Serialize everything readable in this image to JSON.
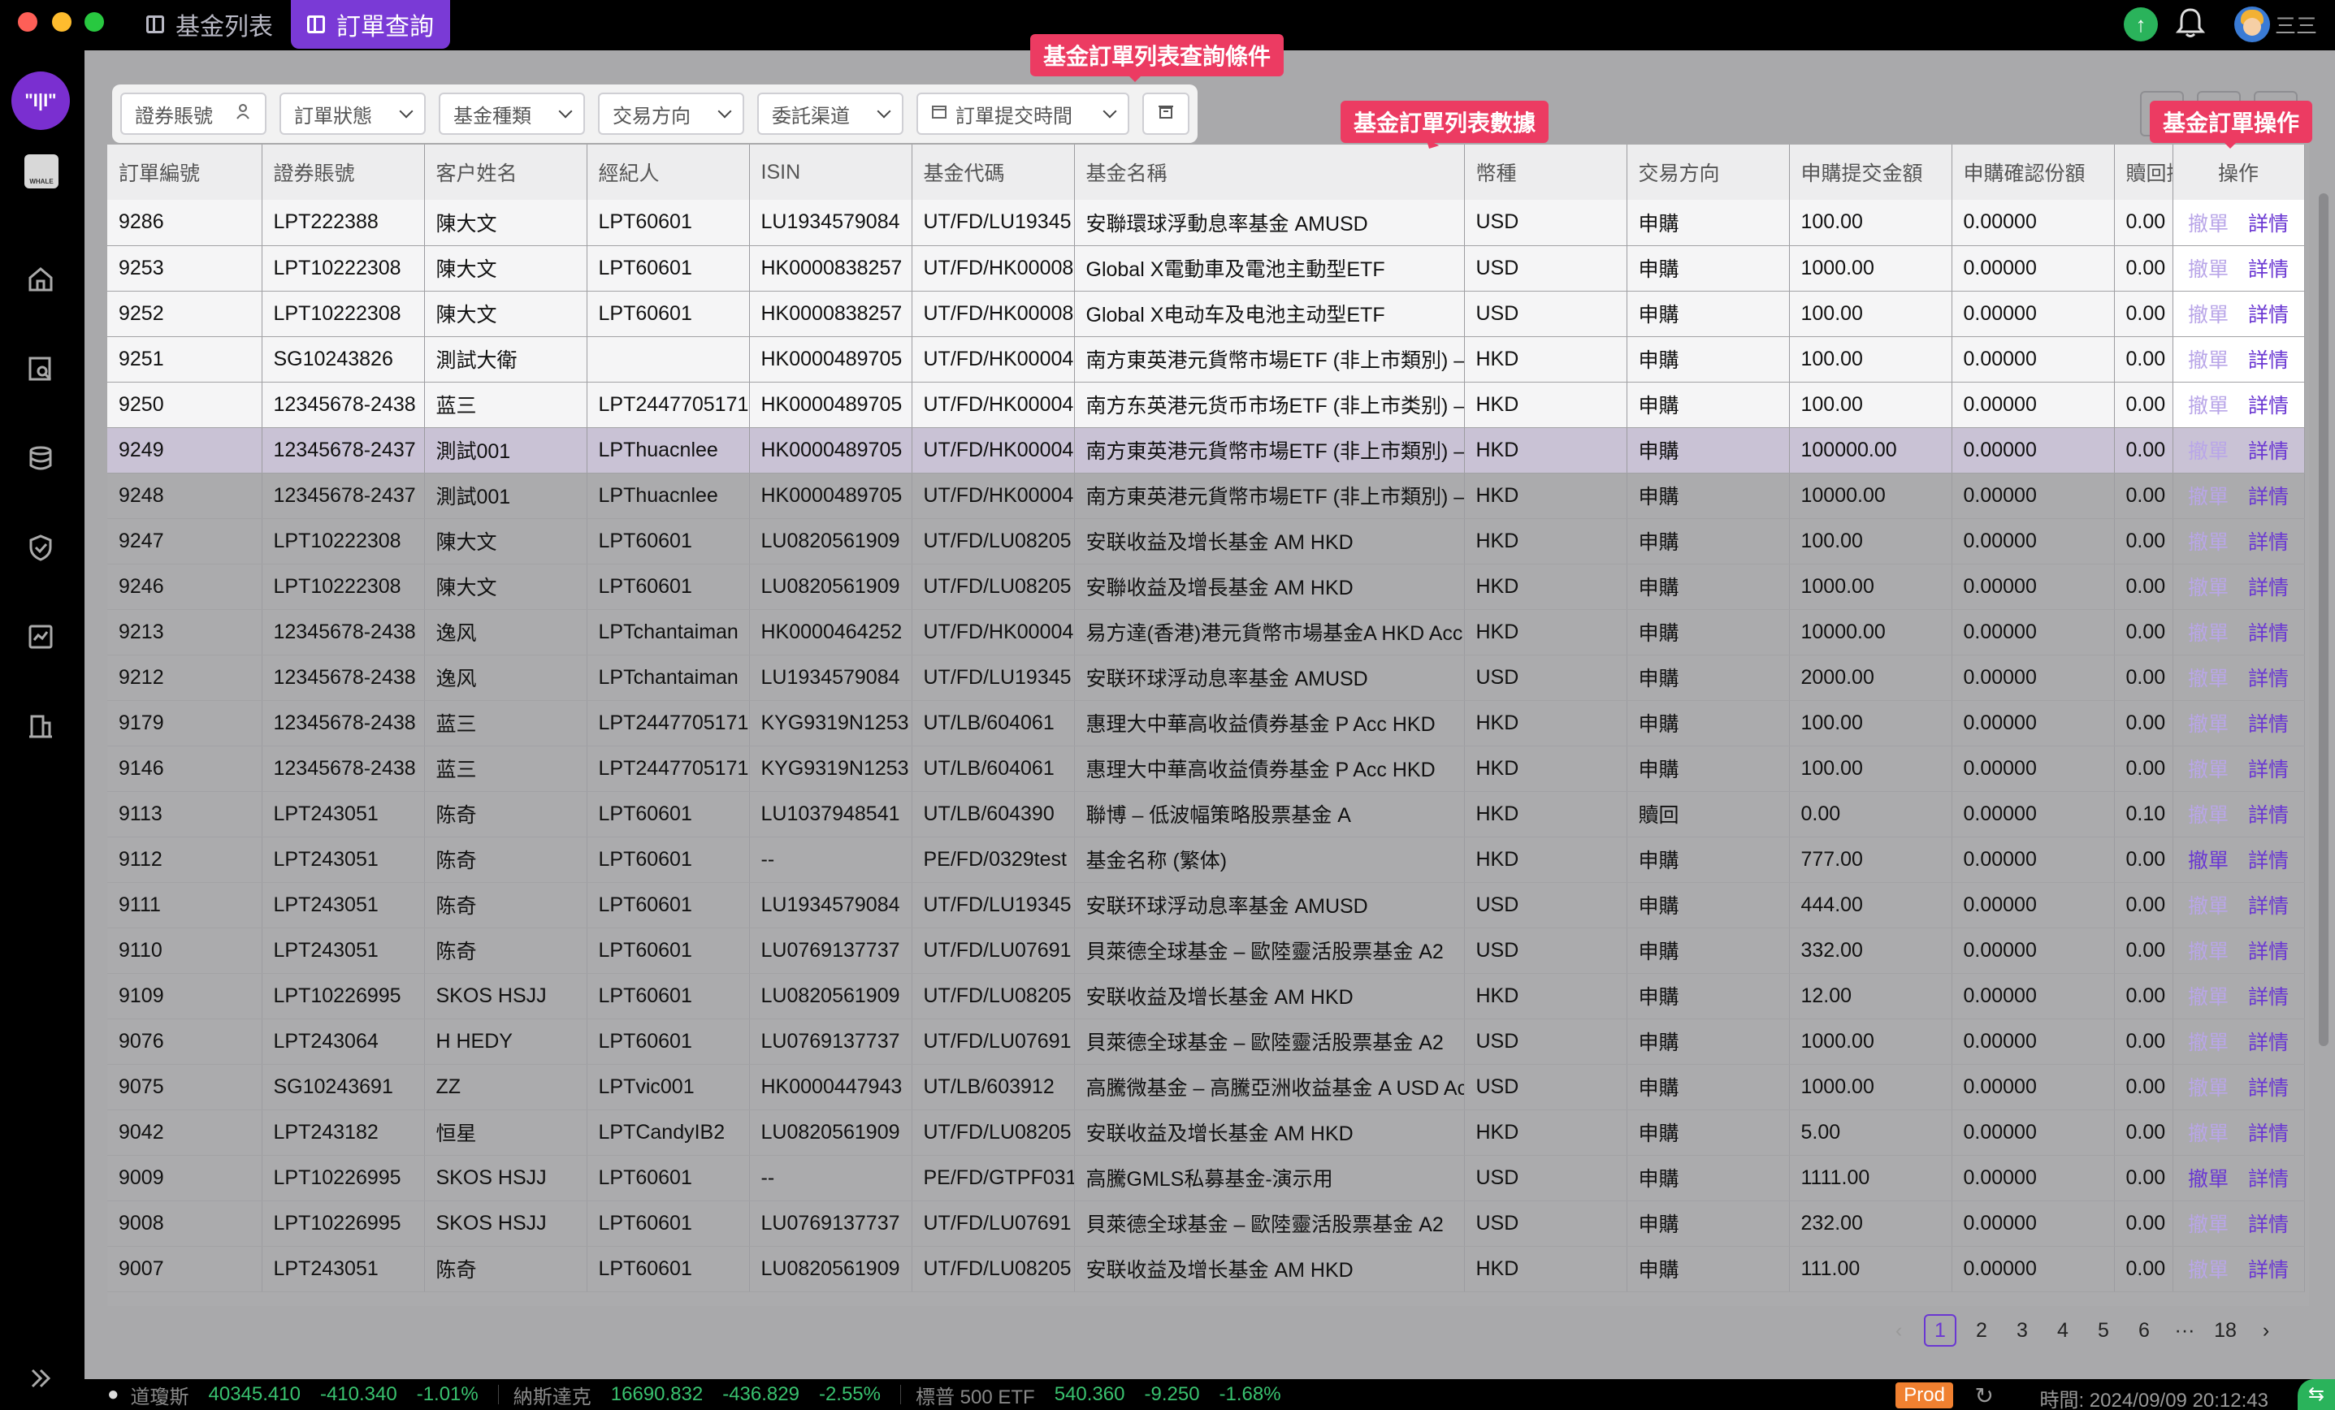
{
  "titlebar": {
    "tabs": [
      {
        "label": "基金列表",
        "active": false
      },
      {
        "label": "訂單查詢",
        "active": true
      }
    ],
    "user_menu": "三三"
  },
  "sidebar": {
    "logo_text": "\"I|I\"",
    "whale_text": "WHALE",
    "items": [
      "home-icon",
      "search-doc-icon",
      "database-icon",
      "shield-icon",
      "report-icon",
      "building-icon"
    ],
    "expand_icon": "double-chevron-right-icon"
  },
  "filters": {
    "account": "證券賬號",
    "status": "訂單狀態",
    "fund_type": "基金種類",
    "direction": "交易方向",
    "channel": "委託渠道",
    "submit_time": "訂單提交時間"
  },
  "annotations": {
    "filters": "基金訂單列表查詢條件",
    "table": "基金訂單列表數據",
    "ops": "基金訂單操作"
  },
  "table": {
    "headers": [
      "訂單編號",
      "證券賬號",
      "客户姓名",
      "經紀人",
      "ISIN",
      "基金代碼",
      "基金名稱",
      "幣種",
      "交易方向",
      "申購提交金額",
      "申購確認份額",
      "贖回提"
    ],
    "ops_header": "操作",
    "cancel_label": "撤單",
    "detail_label": "詳情",
    "rows": [
      {
        "c": [
          "9286",
          "LPT222388",
          "陳大文",
          "LPT60601",
          "LU1934579084",
          "UT/FD/LU19345",
          "安聯環球浮動息率基金 AMUSD",
          "USD",
          "申購",
          "100.00",
          "0.00000",
          "0.00"
        ],
        "style": "hl",
        "cancel": false
      },
      {
        "c": [
          "9253",
          "LPT10222308",
          "陳大文",
          "LPT60601",
          "HK0000838257",
          "UT/FD/HK00008",
          "Global X電動車及電池主動型ETF",
          "USD",
          "申購",
          "1000.00",
          "0.00000",
          "0.00"
        ],
        "style": "hl",
        "cancel": false
      },
      {
        "c": [
          "9252",
          "LPT10222308",
          "陳大文",
          "LPT60601",
          "HK0000838257",
          "UT/FD/HK00008",
          "Global X电动车及电池主动型ETF",
          "USD",
          "申購",
          "100.00",
          "0.00000",
          "0.00"
        ],
        "style": "hl",
        "cancel": false
      },
      {
        "c": [
          "9251",
          "SG10243826",
          "測試大衛",
          "",
          "HK0000489705",
          "UT/FD/HK00004",
          "南方東英港元貨幣市場ETF (非上市類別) – A",
          "HKD",
          "申購",
          "100.00",
          "0.00000",
          "0.00"
        ],
        "style": "hl",
        "cancel": false
      },
      {
        "c": [
          "9250",
          "12345678-2438",
          "蓝三",
          "LPT2447705171",
          "HK0000489705",
          "UT/FD/HK00004",
          "南方东英港元货币市场ETF (非上市类别) – A",
          "HKD",
          "申購",
          "100.00",
          "0.00000",
          "0.00"
        ],
        "style": "hl",
        "cancel": false
      },
      {
        "c": [
          "9249",
          "12345678-2437",
          "測試001",
          "LPThuacnlee",
          "HK0000489705",
          "UT/FD/HK00004",
          "南方東英港元貨幣市場ETF (非上市類別) – A",
          "HKD",
          "申購",
          "100000.00",
          "0.00000",
          "0.00"
        ],
        "style": "sel",
        "cancel": false
      },
      {
        "c": [
          "9248",
          "12345678-2437",
          "測試001",
          "LPThuacnlee",
          "HK0000489705",
          "UT/FD/HK00004",
          "南方東英港元貨幣市場ETF (非上市類別) – A",
          "HKD",
          "申購",
          "10000.00",
          "0.00000",
          "0.00"
        ],
        "style": "",
        "cancel": false
      },
      {
        "c": [
          "9247",
          "LPT10222308",
          "陳大文",
          "LPT60601",
          "LU0820561909",
          "UT/FD/LU08205",
          "安联收益及增长基金 AM HKD",
          "HKD",
          "申購",
          "100.00",
          "0.00000",
          "0.00"
        ],
        "style": "",
        "cancel": false
      },
      {
        "c": [
          "9246",
          "LPT10222308",
          "陳大文",
          "LPT60601",
          "LU0820561909",
          "UT/FD/LU08205",
          "安聯收益及增長基金 AM HKD",
          "HKD",
          "申購",
          "1000.00",
          "0.00000",
          "0.00"
        ],
        "style": "",
        "cancel": false
      },
      {
        "c": [
          "9213",
          "12345678-2438",
          "逸风",
          "LPTchantaiman",
          "HK0000464252",
          "UT/FD/HK00004",
          "易方達(香港)港元貨幣市場基金A HKD Acc",
          "HKD",
          "申購",
          "10000.00",
          "0.00000",
          "0.00"
        ],
        "style": "",
        "cancel": false
      },
      {
        "c": [
          "9212",
          "12345678-2438",
          "逸风",
          "LPTchantaiman",
          "LU1934579084",
          "UT/FD/LU19345",
          "安联环球浮动息率基金 AMUSD",
          "USD",
          "申購",
          "2000.00",
          "0.00000",
          "0.00"
        ],
        "style": "",
        "cancel": false
      },
      {
        "c": [
          "9179",
          "12345678-2438",
          "蓝三",
          "LPT2447705171",
          "KYG9319N1253",
          "UT/LB/604061",
          "惠理大中華高收益債券基金 P Acc HKD",
          "HKD",
          "申購",
          "100.00",
          "0.00000",
          "0.00"
        ],
        "style": "",
        "cancel": false
      },
      {
        "c": [
          "9146",
          "12345678-2438",
          "蓝三",
          "LPT2447705171",
          "KYG9319N1253",
          "UT/LB/604061",
          "惠理大中華高收益債券基金 P Acc HKD",
          "HKD",
          "申購",
          "100.00",
          "0.00000",
          "0.00"
        ],
        "style": "",
        "cancel": false
      },
      {
        "c": [
          "9113",
          "LPT243051",
          "陈奇",
          "LPT60601",
          "LU1037948541",
          "UT/LB/604390",
          "聯博 – 低波幅策略股票基金 A",
          "HKD",
          "贖回",
          "0.00",
          "0.00000",
          "0.10"
        ],
        "style": "",
        "cancel": false
      },
      {
        "c": [
          "9112",
          "LPT243051",
          "陈奇",
          "LPT60601",
          "--",
          "PE/FD/0329test",
          "基金名称 (繁体)",
          "HKD",
          "申購",
          "777.00",
          "0.00000",
          "0.00"
        ],
        "style": "",
        "cancel": true
      },
      {
        "c": [
          "9111",
          "LPT243051",
          "陈奇",
          "LPT60601",
          "LU1934579084",
          "UT/FD/LU19345",
          "安联环球浮动息率基金 AMUSD",
          "USD",
          "申購",
          "444.00",
          "0.00000",
          "0.00"
        ],
        "style": "",
        "cancel": false
      },
      {
        "c": [
          "9110",
          "LPT243051",
          "陈奇",
          "LPT60601",
          "LU0769137737",
          "UT/FD/LU07691",
          "貝萊德全球基金 – 歐陸靈活股票基金 A2",
          "USD",
          "申購",
          "332.00",
          "0.00000",
          "0.00"
        ],
        "style": "",
        "cancel": false
      },
      {
        "c": [
          "9109",
          "LPT10226995",
          "SKOS HSJJ",
          "LPT60601",
          "LU0820561909",
          "UT/FD/LU08205",
          "安联收益及增长基金 AM HKD",
          "HKD",
          "申購",
          "12.00",
          "0.00000",
          "0.00"
        ],
        "style": "",
        "cancel": false
      },
      {
        "c": [
          "9076",
          "LPT243064",
          "H HEDY",
          "LPT60601",
          "LU0769137737",
          "UT/FD/LU07691",
          "貝萊德全球基金 – 歐陸靈活股票基金 A2",
          "USD",
          "申購",
          "1000.00",
          "0.00000",
          "0.00"
        ],
        "style": "",
        "cancel": false
      },
      {
        "c": [
          "9075",
          "SG10243691",
          "ZZ",
          "LPTvic001",
          "HK0000447943",
          "UT/LB/603912",
          "高騰微基金 – 高騰亞洲收益基金 A USD Acc",
          "USD",
          "申購",
          "1000.00",
          "0.00000",
          "0.00"
        ],
        "style": "",
        "cancel": false
      },
      {
        "c": [
          "9042",
          "LPT243182",
          "恒星",
          "LPTCandyIB2",
          "LU0820561909",
          "UT/FD/LU08205",
          "安联收益及增长基金 AM HKD",
          "HKD",
          "申購",
          "5.00",
          "0.00000",
          "0.00"
        ],
        "style": "",
        "cancel": false
      },
      {
        "c": [
          "9009",
          "LPT10226995",
          "SKOS HSJJ",
          "LPT60601",
          "--",
          "PE/FD/GTPF031",
          "高騰GMLS私募基金-演示用",
          "USD",
          "申購",
          "1111.00",
          "0.00000",
          "0.00"
        ],
        "style": "",
        "cancel": true
      },
      {
        "c": [
          "9008",
          "LPT10226995",
          "SKOS HSJJ",
          "LPT60601",
          "LU0769137737",
          "UT/FD/LU07691",
          "貝萊德全球基金 – 歐陸靈活股票基金 A2",
          "USD",
          "申購",
          "232.00",
          "0.00000",
          "0.00"
        ],
        "style": "",
        "cancel": false
      },
      {
        "c": [
          "9007",
          "LPT243051",
          "陈奇",
          "LPT60601",
          "LU0820561909",
          "UT/FD/LU08205",
          "安联收益及增长基金 AM HKD",
          "HKD",
          "申購",
          "111.00",
          "0.00000",
          "0.00"
        ],
        "style": "",
        "cancel": false
      }
    ]
  },
  "pagination": {
    "pages": [
      "1",
      "2",
      "3",
      "4",
      "5",
      "6",
      "···",
      "18"
    ],
    "current": "1"
  },
  "ticker": [
    {
      "name": "道瓊斯",
      "value": "40345.410",
      "change": "-410.340",
      "pct": "-1.01%"
    },
    {
      "name": "納斯達克",
      "value": "16690.832",
      "change": "-436.829",
      "pct": "-2.55%"
    },
    {
      "name": "標普 500 ETF",
      "value": "540.360",
      "change": "-9.250",
      "pct": "-1.68%"
    }
  ],
  "env": "Prod",
  "time": "時間: 2024/09/09 20:12:43",
  "colors": {
    "accent": "#7a3ad6",
    "tag": "#ec3b62",
    "up": "#39c26f",
    "env": "#f08030"
  }
}
